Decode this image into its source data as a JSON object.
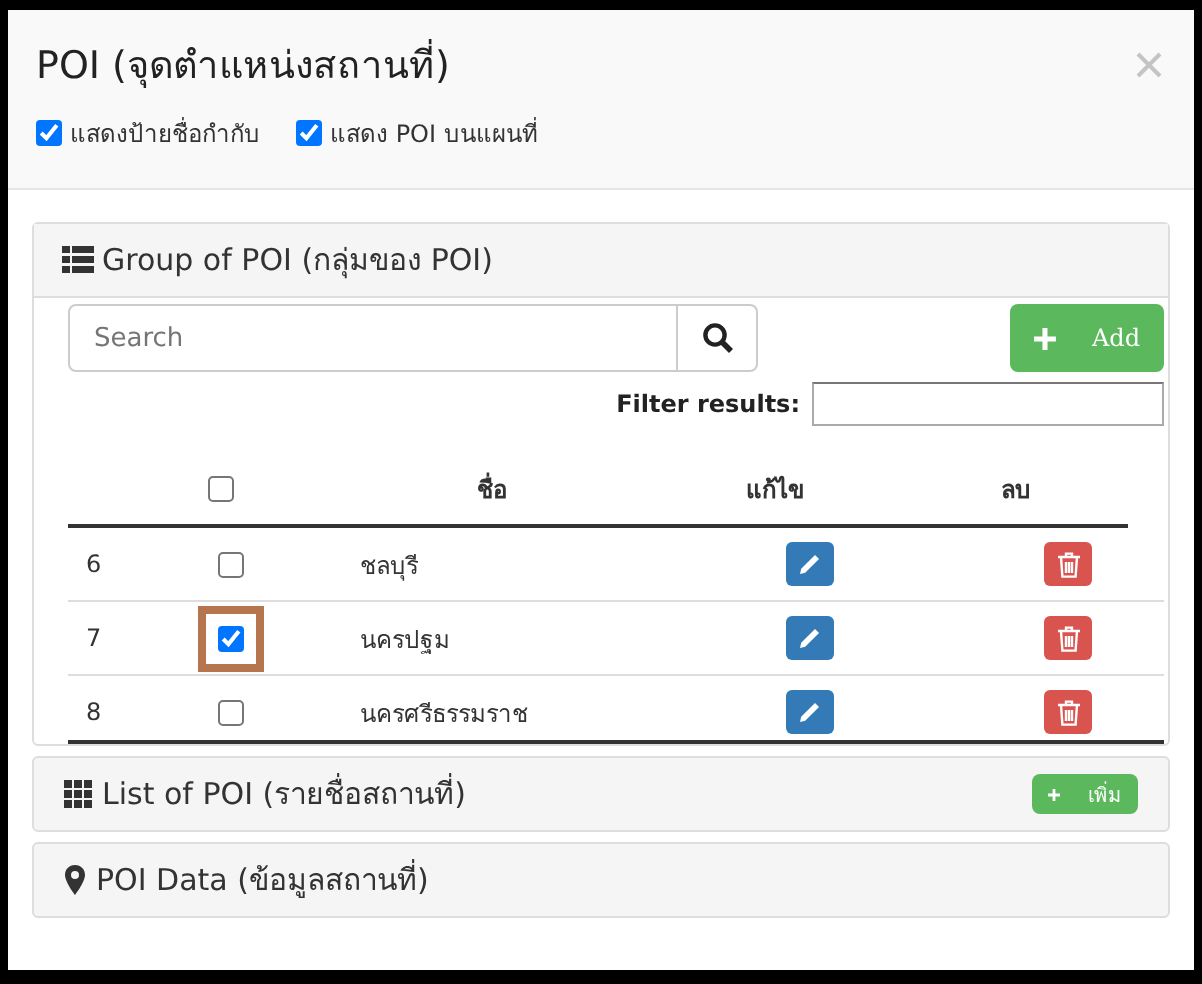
{
  "window": {
    "title": "POI (จุดตำแหน่งสถานที่)"
  },
  "options": [
    {
      "label": "แสดงป้ายชื่อกำกับ",
      "checked": true
    },
    {
      "label": "แสดง POI บนแผนที่",
      "checked": true
    }
  ],
  "group_panel": {
    "title": "Group of POI (กลุ่มของ POI)",
    "search": {
      "placeholder": "Search"
    },
    "add_button": "Add",
    "filter_label": "Filter results:",
    "table": {
      "columns": [
        "ชื่อ",
        "แก้ไข",
        "ลบ"
      ],
      "all_checked": false,
      "rows": [
        {
          "number": "6",
          "name": "ชลบุรี",
          "checked": false,
          "highlighted": false
        },
        {
          "number": "7",
          "name": "นครปฐม",
          "checked": true,
          "highlighted": true
        },
        {
          "number": "8",
          "name": "นครศรีธรรมราช",
          "checked": false,
          "highlighted": false
        }
      ]
    }
  },
  "list_panel": {
    "title": "List of POI (รายชื่อสถานที่)",
    "add_button": "เพิ่ม"
  },
  "data_panel": {
    "title": "POI Data (ข้อมูลสถานที่)"
  }
}
